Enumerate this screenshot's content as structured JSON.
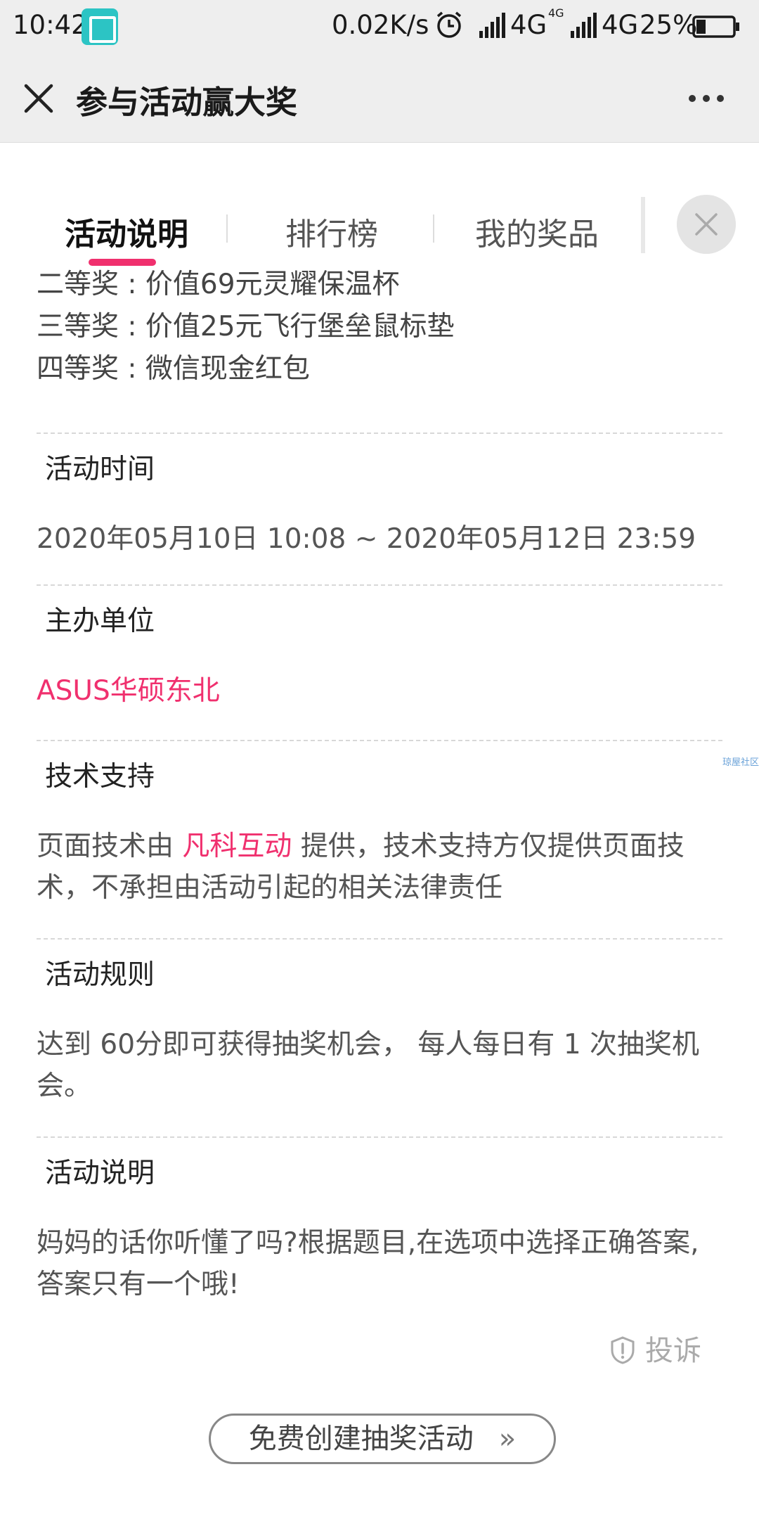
{
  "status_bar": {
    "time": "10:42",
    "speed": "0.02K/s",
    "net1": "4G",
    "net_small": "4G",
    "net2": "4G",
    "battery": "25%"
  },
  "title_bar": {
    "title": "参与活动赢大奖"
  },
  "tabs": [
    {
      "label": "活动说明",
      "active": true
    },
    {
      "label": "排行榜",
      "active": false
    },
    {
      "label": "我的奖品",
      "active": false
    }
  ],
  "prizes": [
    "二等奖 : 价值69元灵耀保温杯",
    "三等奖 : 价值25元飞行堡垒鼠标垫",
    "四等奖 : 微信现金红包"
  ],
  "sections": {
    "time": {
      "heading": "活动时间",
      "body": "2020年05月10日 10:08 ~ 2020年05月12日 23:59"
    },
    "organizer": {
      "heading": "主办单位",
      "body": "ASUS华硕东北"
    },
    "tech": {
      "heading": "技术支持",
      "body_prefix": "页面技术由 ",
      "link": "凡科互动",
      "body_suffix": " 提供，技术支持方仅提供页面技术，不承担由活动引起的相关法律责任"
    },
    "rules": {
      "heading": "活动规则",
      "body": "达到 60分即可获得抽奖机会， 每人每日有 1 次抽奖机会。"
    },
    "desc": {
      "heading": "活动说明",
      "body": "妈妈的话你听懂了吗?根据题目,在选项中选择正确答案,答案只有一个哦!"
    }
  },
  "side_watermark": "琼屋社区",
  "footer": {
    "report_label": "投诉",
    "create_button": "免费创建抽奖活动"
  },
  "colors": {
    "accent": "#f0306e",
    "bar_bg": "#eeeeee"
  }
}
